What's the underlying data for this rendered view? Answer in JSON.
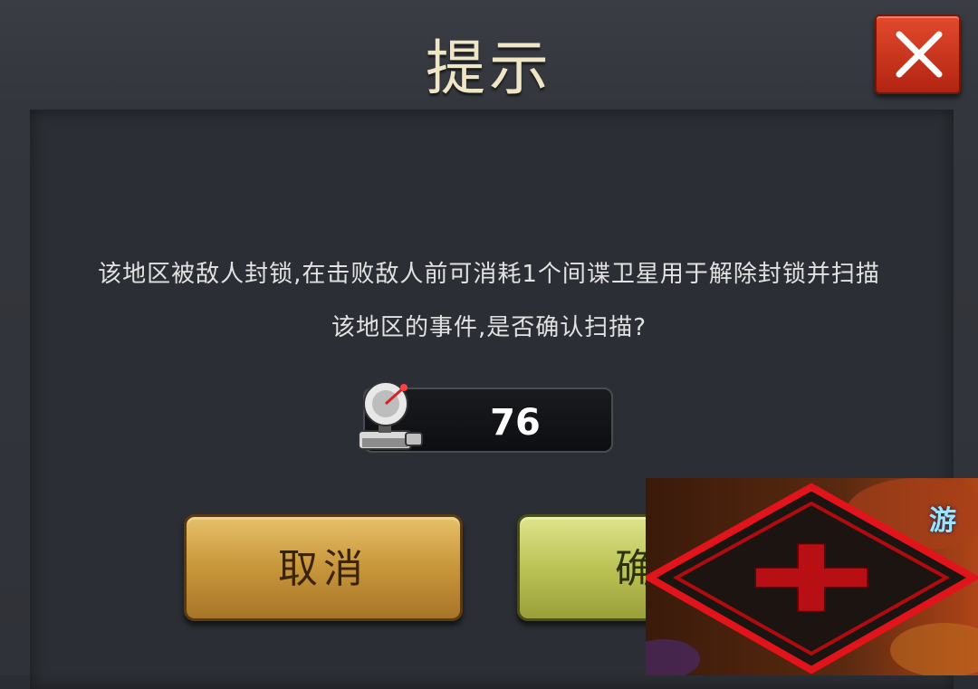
{
  "dialog": {
    "title": "提示",
    "close_icon": "close-x-icon",
    "message_line1": "该地区被敌人封锁,在击败敌人前可消耗1个间谍卫星用于解除封锁并扫描",
    "message_line2": "该地区的事件,是否确认扫描?",
    "item": {
      "icon": "spy-satellite-icon",
      "count": "76"
    },
    "cancel_label": "取消",
    "confirm_label": "确"
  },
  "map_overlay": {
    "tile_icon": "blocked-tile-red-x-icon",
    "corner_text": "游"
  },
  "colors": {
    "close_button": "#c8321b",
    "cancel_button": "#c8963a",
    "confirm_button": "#bcc355",
    "tile_border": "#e0141a"
  }
}
